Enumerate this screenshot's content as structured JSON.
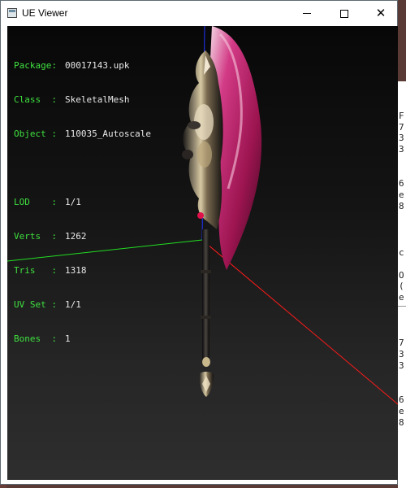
{
  "window": {
    "title": "UE Viewer"
  },
  "titlebar_buttons": {
    "minimize": "minimize",
    "maximize": "maximize",
    "close": "✕"
  },
  "info": {
    "package": {
      "key": "Package:",
      "value": "00017143.upk"
    },
    "class": {
      "key": "Class  :",
      "value": "SkeletalMesh"
    },
    "object": {
      "key": "Object :",
      "value": "110035_Autoscale"
    },
    "lod": {
      "key": "LOD    :",
      "value": "1/1"
    },
    "verts": {
      "key": "Verts  :",
      "value": "1262"
    },
    "tris": {
      "key": "Tris   :",
      "value": "1318"
    },
    "uvset": {
      "key": "UV Set :",
      "value": "1/1"
    },
    "bones": {
      "key": "Bones  :",
      "value": "1"
    }
  },
  "colors": {
    "info_key": "#3fe03f",
    "info_value": "#e8e8e8",
    "axis_x": "#ff1a1a",
    "axis_y": "#22dd22",
    "axis_z": "#2233ff",
    "blade": "#c2185b"
  },
  "background_window": {
    "lines": [
      "F",
      "7",
      "3",
      "3",
      "6",
      "e",
      "8",
      "c",
      "O",
      "(",
      "e",
      "7",
      "3",
      "3",
      "6",
      "e",
      "8"
    ]
  }
}
